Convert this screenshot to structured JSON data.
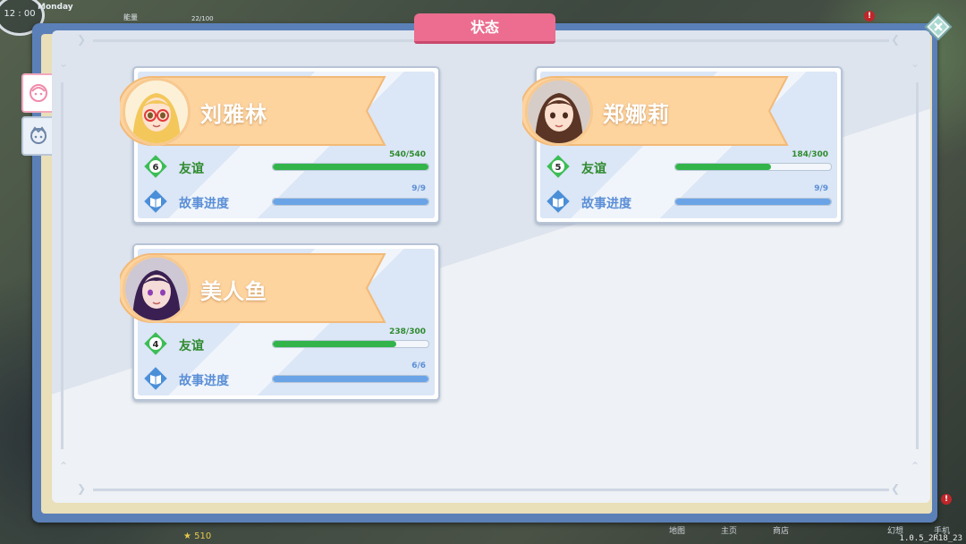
{
  "hud": {
    "clock": "12 : 00",
    "day": "Monday",
    "bar_label": "能量",
    "bar_count": "22/100",
    "stars": "510",
    "nav": [
      "地图",
      "主页",
      "商店",
      "幻想",
      "手机"
    ],
    "version": "1.0.5_2R18_23",
    "notif": "!"
  },
  "panel": {
    "title": "状态"
  },
  "stats_labels": {
    "friendship": "友谊",
    "story": "故事进度"
  },
  "colors": {
    "friendship_bar": "#32b44a",
    "story_bar": "#6aa4e6",
    "friendship_text": "#2f8a2f",
    "story_text": "#5b8fd6",
    "ribbon": "#fdd39e",
    "title_banner": "#ec6d8f"
  },
  "characters": [
    {
      "name": "刘雅林",
      "avatar": "blonde-girl-red-glasses",
      "friendship_level": "6",
      "friendship_value": "540/540",
      "friendship_fraction": 1.0,
      "story_value": "9/9",
      "story_fraction": 1.0
    },
    {
      "name": "郑娜莉",
      "avatar": "brunette-girl",
      "friendship_level": "5",
      "friendship_value": "184/300",
      "friendship_fraction": 0.613,
      "story_value": "9/9",
      "story_fraction": 1.0
    },
    {
      "name": "美人鱼",
      "avatar": "purple-hair-girl",
      "friendship_level": "4",
      "friendship_value": "238/300",
      "friendship_fraction": 0.793,
      "story_value": "6/6",
      "story_fraction": 1.0
    }
  ]
}
